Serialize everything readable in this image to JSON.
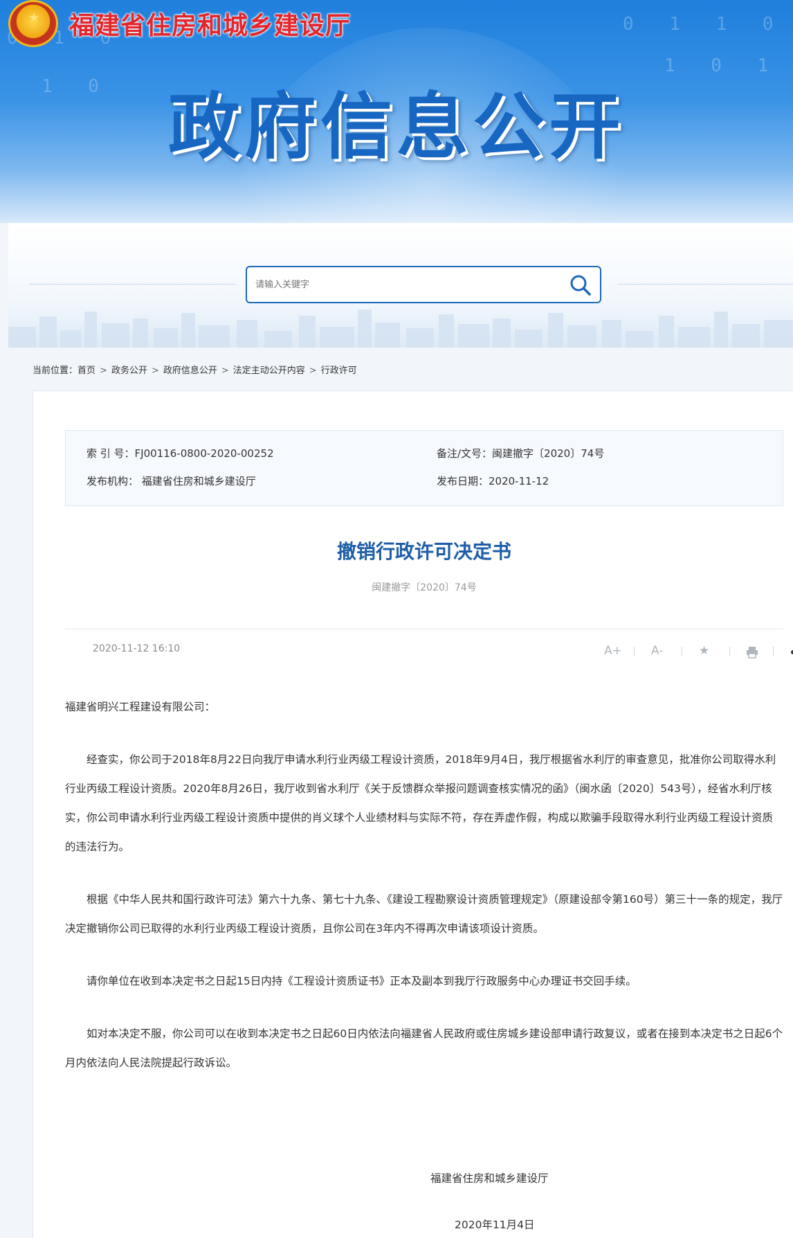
{
  "header": {
    "site_name": "福建省住房和城乡建设厅",
    "page_title": "政府信息公开"
  },
  "search": {
    "placeholder": "请输入关键字"
  },
  "breadcrumb": {
    "prefix": "当前位置：",
    "items": [
      "首页",
      "政务公开",
      "政府信息公开",
      "法定主动公开内容",
      "行政许可"
    ],
    "separator": ">"
  },
  "meta": {
    "index_no": "索 引 号：FJ00116-0800-2020-00252",
    "doc_no": "备注/文号：闽建撤字〔2020〕74号",
    "publisher": "发布机构： 福建省住房和城乡建设厅",
    "publish_date": "发布日期：2020-11-12"
  },
  "document": {
    "title": "撤销行政许可决定书",
    "number": "闽建撤字〔2020〕74号",
    "timestamp": "2020-11-12 16:10",
    "addressee": "福建省明兴工程建设有限公司：",
    "paragraphs": [
      "经查实，你公司于2018年8月22日向我厅申请水利行业丙级工程设计资质，2018年9月4日，我厅根据省水利厅的审查意见，批准你公司取得水利行业丙级工程设计资质。2020年8月26日，我厅收到省水利厅《关于反馈群众举报问题调查核实情况的函》（闽水函〔2020〕543号），经省水利厅核实，你公司申请水利行业丙级工程设计资质中提供的肖义球个人业绩材料与实际不符，存在弄虚作假，构成以欺骗手段取得水利行业丙级工程设计资质的违法行为。",
      "根据《中华人民共和国行政许可法》第六十九条、第七十九条、《建设工程勘察设计资质管理规定》（原建设部令第160号）第三十一条的规定，我厅决定撤销你公司已取得的水利行业丙级工程设计资质，且你公司在3年内不得再次申请该项设计资质。",
      "请你单位在收到本决定书之日起15日内持《工程设计资质证书》正本及副本到我厅行政服务中心办理证书交回手续。",
      "如对本决定不服，你公司可以在收到本决定书之日起60日内依法向福建省人民政府或住房城乡建设部申请行政复议，或者在接到本决定书之日起6个月内依法向人民法院提起行政诉讼。"
    ],
    "signature": "福建省住房和城乡建设厅",
    "sign_date": "2020年11月4日"
  },
  "tools": {
    "font_up": "A+",
    "font_down": "A-"
  },
  "colors": {
    "brand_blue": "#1e5ea8",
    "site_name_red": "#e4262b"
  }
}
